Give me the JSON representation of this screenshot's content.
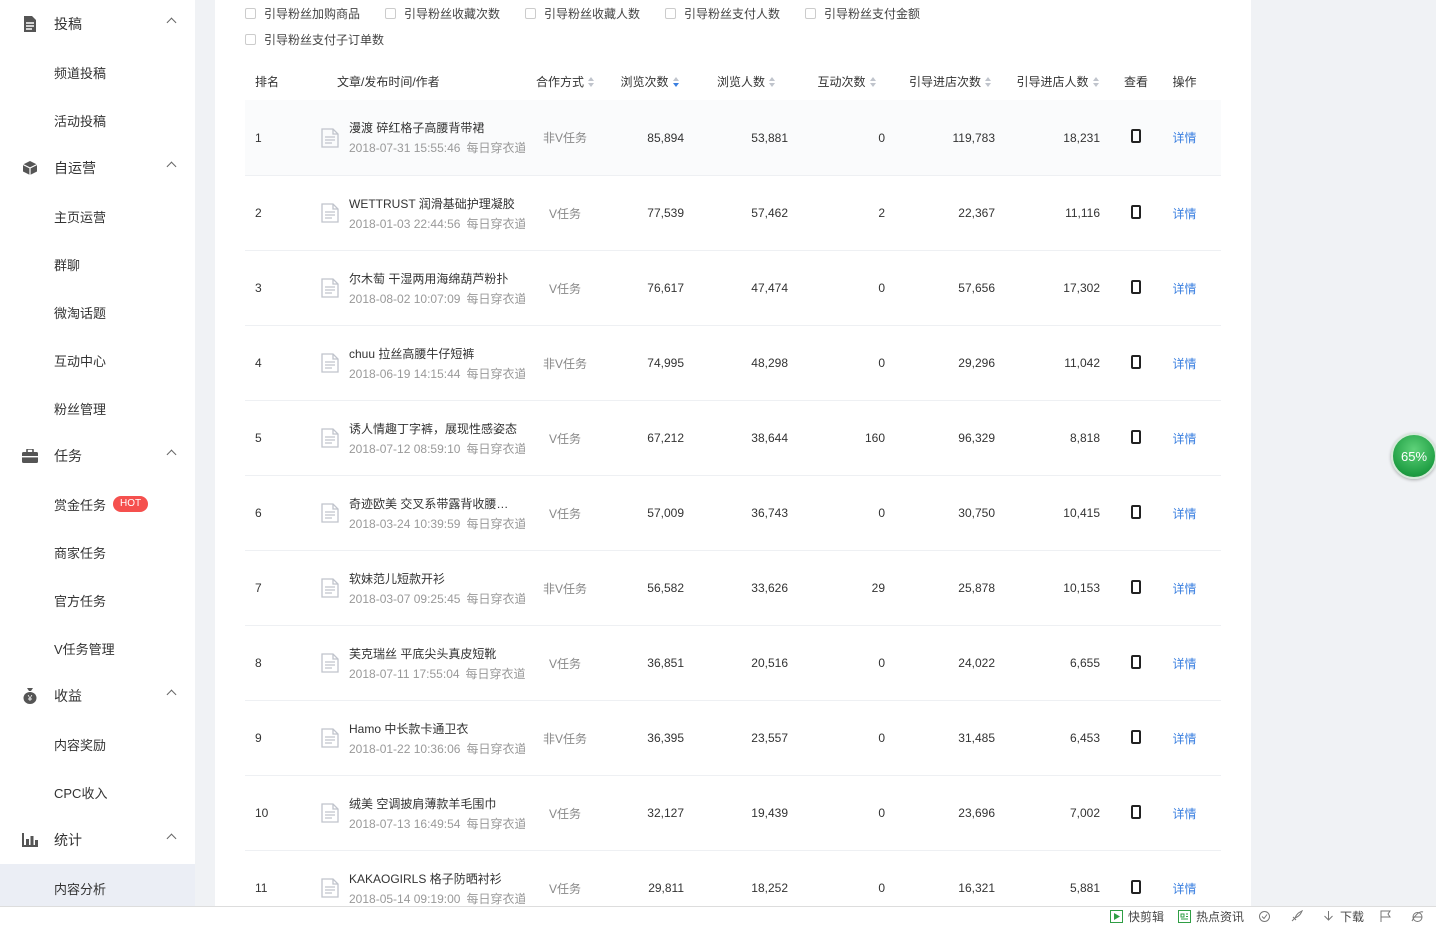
{
  "sidebar": {
    "groups": [
      {
        "label": "投稿",
        "icon": "document-icon",
        "items": [
          "频道投稿",
          "活动投稿"
        ]
      },
      {
        "label": "自运营",
        "icon": "cube-icon",
        "items": [
          "主页运营",
          "群聊",
          "微淘话题",
          "互动中心",
          "粉丝管理"
        ]
      },
      {
        "label": "任务",
        "icon": "briefcase-icon",
        "items": [
          "赏金任务",
          "商家任务",
          "官方任务",
          "V任务管理"
        ]
      },
      {
        "label": "收益",
        "icon": "money-bag-icon",
        "items": [
          "内容奖励",
          "CPC收入"
        ]
      },
      {
        "label": "统计",
        "icon": "bar-chart-icon",
        "items": [
          "内容分析"
        ]
      }
    ],
    "hot_badge": "HOT",
    "active_item": "内容分析"
  },
  "filters": [
    "引导粉丝加购商品",
    "引导粉丝收藏次数",
    "引导粉丝收藏人数",
    "引导粉丝支付人数",
    "引导粉丝支付金额",
    "引导粉丝支付子订单数"
  ],
  "table": {
    "headers": {
      "rank": "排名",
      "article": "文章/发布时间/作者",
      "coop": "合作方式",
      "views": "浏览次数",
      "viewers": "浏览人数",
      "interactions": "互动次数",
      "store_visits": "引导进店次数",
      "store_visitors": "引导进店人数",
      "view": "查看",
      "op": "操作"
    },
    "detail_label": "详情",
    "rows": [
      {
        "rank": "1",
        "title": "漫渡 碎红格子高腰背带裙",
        "time": "2018-07-31 15:55:46",
        "author": "每日穿衣道",
        "coop": "非V任务",
        "views": "85,894",
        "viewers": "53,881",
        "interactions": "0",
        "store_visits": "119,783",
        "store_visitors": "18,231"
      },
      {
        "rank": "2",
        "title": "WETTRUST 润滑基础护理凝胶",
        "time": "2018-01-03 22:44:56",
        "author": "每日穿衣道",
        "coop": "V任务",
        "views": "77,539",
        "viewers": "57,462",
        "interactions": "2",
        "store_visits": "22,367",
        "store_visitors": "11,116"
      },
      {
        "rank": "3",
        "title": "尔木萄 干湿两用海绵葫芦粉扑",
        "time": "2018-08-02 10:07:09",
        "author": "每日穿衣道",
        "coop": "V任务",
        "views": "76,617",
        "viewers": "47,474",
        "interactions": "0",
        "store_visits": "57,656",
        "store_visitors": "17,302"
      },
      {
        "rank": "4",
        "title": "chuu 拉丝高腰牛仔短裤",
        "time": "2018-06-19 14:15:44",
        "author": "每日穿衣道",
        "coop": "非V任务",
        "views": "74,995",
        "viewers": "48,298",
        "interactions": "0",
        "store_visits": "29,296",
        "store_visitors": "11,042"
      },
      {
        "rank": "5",
        "title": "诱人情趣丁字裤，展现性感姿态",
        "time": "2018-07-12 08:59:10",
        "author": "每日穿衣道",
        "coop": "V任务",
        "views": "67,212",
        "viewers": "38,644",
        "interactions": "160",
        "store_visits": "96,329",
        "store_visitors": "8,818"
      },
      {
        "rank": "6",
        "title": "奇迹欧美 交叉系带露背收腰吊...",
        "time": "2018-03-24 10:39:59",
        "author": "每日穿衣道",
        "coop": "V任务",
        "views": "57,009",
        "viewers": "36,743",
        "interactions": "0",
        "store_visits": "30,750",
        "store_visitors": "10,415"
      },
      {
        "rank": "7",
        "title": "软妹范儿短款开衫",
        "time": "2018-03-07 09:25:45",
        "author": "每日穿衣道",
        "coop": "非V任务",
        "views": "56,582",
        "viewers": "33,626",
        "interactions": "29",
        "store_visits": "25,878",
        "store_visitors": "10,153"
      },
      {
        "rank": "8",
        "title": "芙克瑞丝 平底尖头真皮短靴",
        "time": "2018-07-11 17:55:04",
        "author": "每日穿衣道",
        "coop": "V任务",
        "views": "36,851",
        "viewers": "20,516",
        "interactions": "0",
        "store_visits": "24,022",
        "store_visitors": "6,655"
      },
      {
        "rank": "9",
        "title": "Hamo 中长款卡通卫衣",
        "time": "2018-01-22 10:36:06",
        "author": "每日穿衣道",
        "coop": "非V任务",
        "views": "36,395",
        "viewers": "23,557",
        "interactions": "0",
        "store_visits": "31,485",
        "store_visitors": "6,453"
      },
      {
        "rank": "10",
        "title": "绒美 空调披肩薄款羊毛围巾",
        "time": "2018-07-13 16:49:54",
        "author": "每日穿衣道",
        "coop": "V任务",
        "views": "32,127",
        "viewers": "19,439",
        "interactions": "0",
        "store_visits": "23,696",
        "store_visitors": "7,002"
      },
      {
        "rank": "11",
        "title": "KAKAOGIRLS 格子防晒衬衫",
        "time": "2018-05-14 09:19:00",
        "author": "每日穿衣道",
        "coop": "V任务",
        "views": "29,811",
        "viewers": "18,252",
        "interactions": "0",
        "store_visits": "16,321",
        "store_visitors": "5,881"
      }
    ]
  },
  "floating_badge": "65%",
  "statusbar": {
    "items": [
      "快剪辑",
      "热点资讯",
      "",
      "",
      "下载",
      "",
      ""
    ]
  },
  "colors": {
    "accent": "#3a7fe0",
    "hot": "#f5504e",
    "badge": "#1f9e43"
  }
}
